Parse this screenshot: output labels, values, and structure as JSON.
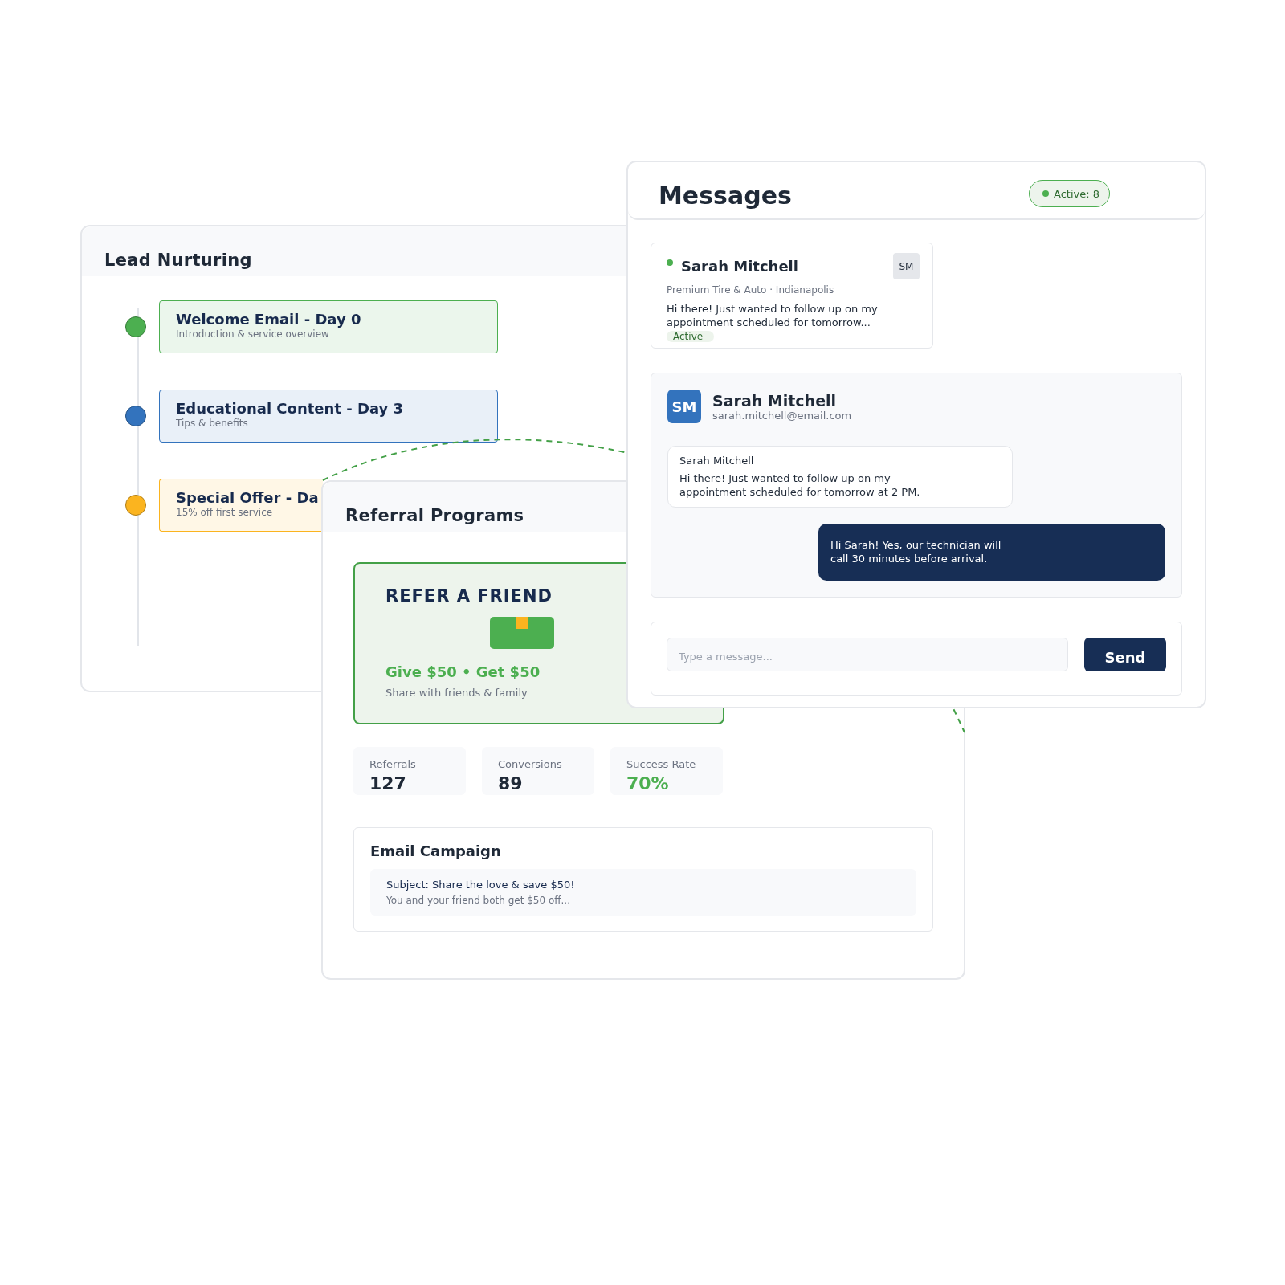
{
  "lead_nurturing": {
    "title": "Lead Nurturing",
    "steps": [
      {
        "title": "Welcome Email - Day 0",
        "subtitle": "Introduction & service overview",
        "color": "#4caf50"
      },
      {
        "title": "Educational Content - Day 3",
        "subtitle": "Tips & benefits",
        "color": "#3373bd"
      },
      {
        "title": "Special Offer - Da",
        "subtitle": "15% off first service",
        "color": "#fbb41f"
      }
    ]
  },
  "referral": {
    "title": "Referral Programs",
    "promo": {
      "heading": "REFER A FRIEND",
      "offer": "Give $50 • Get $50",
      "note": "Share with friends & family"
    },
    "stats": [
      {
        "label": "Referrals",
        "value": "127",
        "kind": "plain"
      },
      {
        "label": "Conversions",
        "value": "89",
        "kind": "plain"
      },
      {
        "label": "Success Rate",
        "value": "70%",
        "kind": "highlight"
      }
    ],
    "email_campaign": {
      "title": "Email Campaign",
      "subject": "Subject: Share the love & save $50!",
      "preview": "You and your friend both get $50 off..."
    }
  },
  "messages": {
    "title": "Messages",
    "active_badge": "Active: 8",
    "contact": {
      "name": "Sarah Mitchell",
      "online": true,
      "initials": "SM",
      "company": "Premium Tire & Auto · Indianapolis",
      "preview": "Hi there! Just wanted to follow up on my appointment scheduled for tomorrow...",
      "status": "Active"
    },
    "conversation": {
      "initials": "SM",
      "name": "Sarah Mitchell",
      "email": "sarah.mitchell@email.com",
      "messages": [
        {
          "kind": "incoming",
          "sender": "Sarah Mitchell",
          "text": "Hi there! Just wanted to follow up on my appointment scheduled for tomorrow at 2 PM."
        },
        {
          "kind": "outgoing",
          "text": "Hi Sarah! Yes, our technician will call 30 minutes before arrival."
        }
      ]
    },
    "composer": {
      "placeholder": "Type a message...",
      "send": "Send"
    }
  }
}
